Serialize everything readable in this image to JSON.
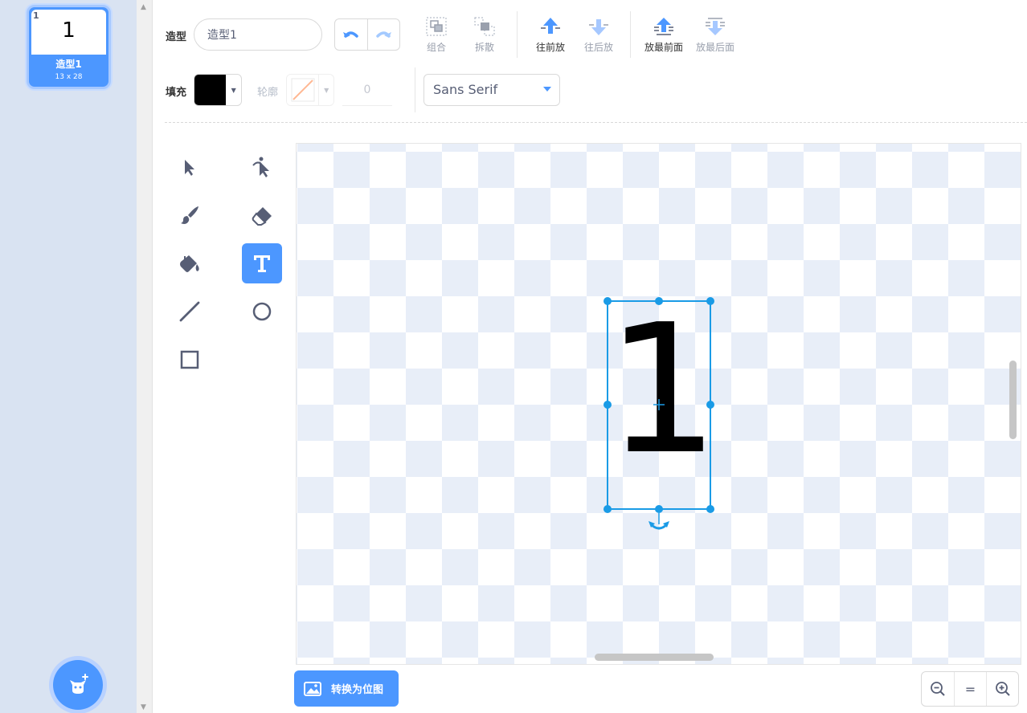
{
  "costume_list": {
    "items": [
      {
        "index": "1",
        "thumb_text": "1",
        "name": "造型1",
        "size": "13 x 28"
      }
    ]
  },
  "toolbar": {
    "costume_label": "造型",
    "costume_name": "造型1",
    "group_label": "组合",
    "ungroup_label": "拆散",
    "forward_label": "往前放",
    "backward_label": "往后放",
    "front_label": "放最前面",
    "back_label": "放最后面",
    "fill_label": "填充",
    "outline_label": "轮廓",
    "outline_width": "0",
    "font": "Sans Serif",
    "fill_color": "#000000"
  },
  "canvas": {
    "text": "1"
  },
  "bottom": {
    "convert_label": "转换为位图",
    "zoom_reset": "="
  },
  "colors": {
    "accent": "#4c97ff",
    "selection": "#1a9be6"
  }
}
